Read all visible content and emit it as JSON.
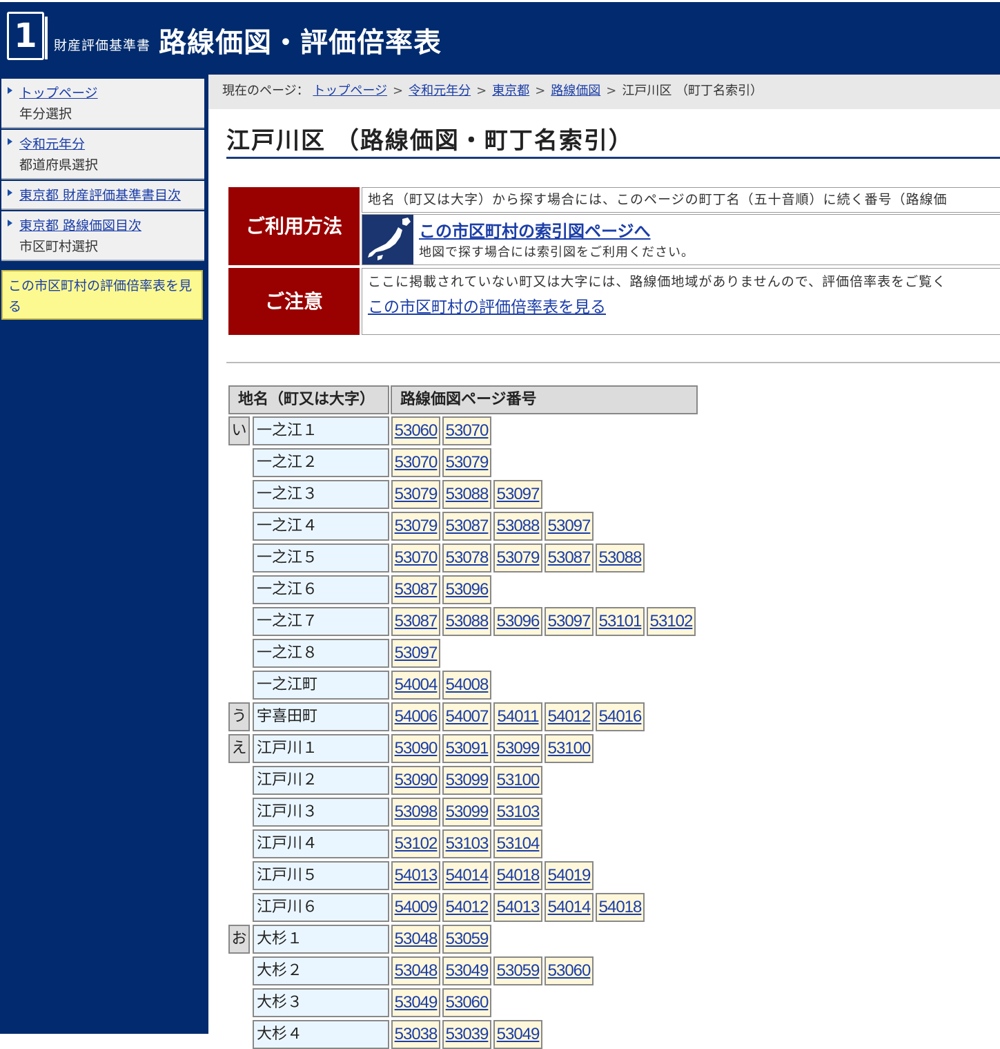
{
  "header": {
    "logo_number": "1",
    "subtitle": "財産評価基準書",
    "title": "路線価図・評価倍率表"
  },
  "sidebar": {
    "items": [
      {
        "link": "トップページ",
        "sub": "年分選択"
      },
      {
        "link": "令和元年分",
        "sub": "都道府県選択"
      },
      {
        "link": "東京都 財産評価基準書目次",
        "sub": ""
      },
      {
        "link": "東京都 路線価図目次",
        "sub": "市区町村選択"
      }
    ],
    "yellow_link": "この市区町村の評価倍率表を見る"
  },
  "breadcrumb": {
    "prefix": "現在のページ：",
    "links": [
      "トップページ",
      "令和元年分",
      "東京都",
      "路線価図"
    ],
    "current": "江戸川区 （町丁名索引）"
  },
  "page_title": "江戸川区 （路線価図・町丁名索引）",
  "usage": {
    "label": "ご利用方法",
    "text": "地名（町又は大字）から探す場合には、このページの町丁名（五十音順）に続く番号（路線価",
    "map_link": "この市区町村の索引図ページへ",
    "map_desc": "地図で探す場合には索引図をご利用ください。"
  },
  "caution": {
    "label": "ご注意",
    "text": "ここに掲載されていない町又は大字には、路線価地域がありませんので、評価倍率表をご覧く",
    "link": "この市区町村の評価倍率表を見る"
  },
  "table": {
    "headers": [
      "地名（町又は大字）",
      "路線価図ページ番号"
    ],
    "rows": [
      {
        "kana": "い",
        "place": "一之江１",
        "pages": [
          "53060",
          "53070"
        ]
      },
      {
        "kana": "",
        "place": "一之江２",
        "pages": [
          "53070",
          "53079"
        ]
      },
      {
        "kana": "",
        "place": "一之江３",
        "pages": [
          "53079",
          "53088",
          "53097"
        ]
      },
      {
        "kana": "",
        "place": "一之江４",
        "pages": [
          "53079",
          "53087",
          "53088",
          "53097"
        ]
      },
      {
        "kana": "",
        "place": "一之江５",
        "pages": [
          "53070",
          "53078",
          "53079",
          "53087",
          "53088"
        ]
      },
      {
        "kana": "",
        "place": "一之江６",
        "pages": [
          "53087",
          "53096"
        ]
      },
      {
        "kana": "",
        "place": "一之江７",
        "pages": [
          "53087",
          "53088",
          "53096",
          "53097",
          "53101",
          "53102"
        ]
      },
      {
        "kana": "",
        "place": "一之江８",
        "pages": [
          "53097"
        ]
      },
      {
        "kana": "",
        "place": "一之江町",
        "pages": [
          "54004",
          "54008"
        ]
      },
      {
        "kana": "う",
        "place": "宇喜田町",
        "pages": [
          "54006",
          "54007",
          "54011",
          "54012",
          "54016"
        ]
      },
      {
        "kana": "え",
        "place": "江戸川１",
        "pages": [
          "53090",
          "53091",
          "53099",
          "53100"
        ]
      },
      {
        "kana": "",
        "place": "江戸川２",
        "pages": [
          "53090",
          "53099",
          "53100"
        ]
      },
      {
        "kana": "",
        "place": "江戸川３",
        "pages": [
          "53098",
          "53099",
          "53103"
        ]
      },
      {
        "kana": "",
        "place": "江戸川４",
        "pages": [
          "53102",
          "53103",
          "53104"
        ]
      },
      {
        "kana": "",
        "place": "江戸川５",
        "pages": [
          "54013",
          "54014",
          "54018",
          "54019"
        ]
      },
      {
        "kana": "",
        "place": "江戸川６",
        "pages": [
          "54009",
          "54012",
          "54013",
          "54014",
          "54018"
        ]
      },
      {
        "kana": "お",
        "place": "大杉１",
        "pages": [
          "53048",
          "53059"
        ]
      },
      {
        "kana": "",
        "place": "大杉２",
        "pages": [
          "53048",
          "53049",
          "53059",
          "53060"
        ]
      },
      {
        "kana": "",
        "place": "大杉３",
        "pages": [
          "53049",
          "53060"
        ]
      },
      {
        "kana": "",
        "place": "大杉４",
        "pages": [
          "53038",
          "53039",
          "53049"
        ]
      }
    ]
  }
}
